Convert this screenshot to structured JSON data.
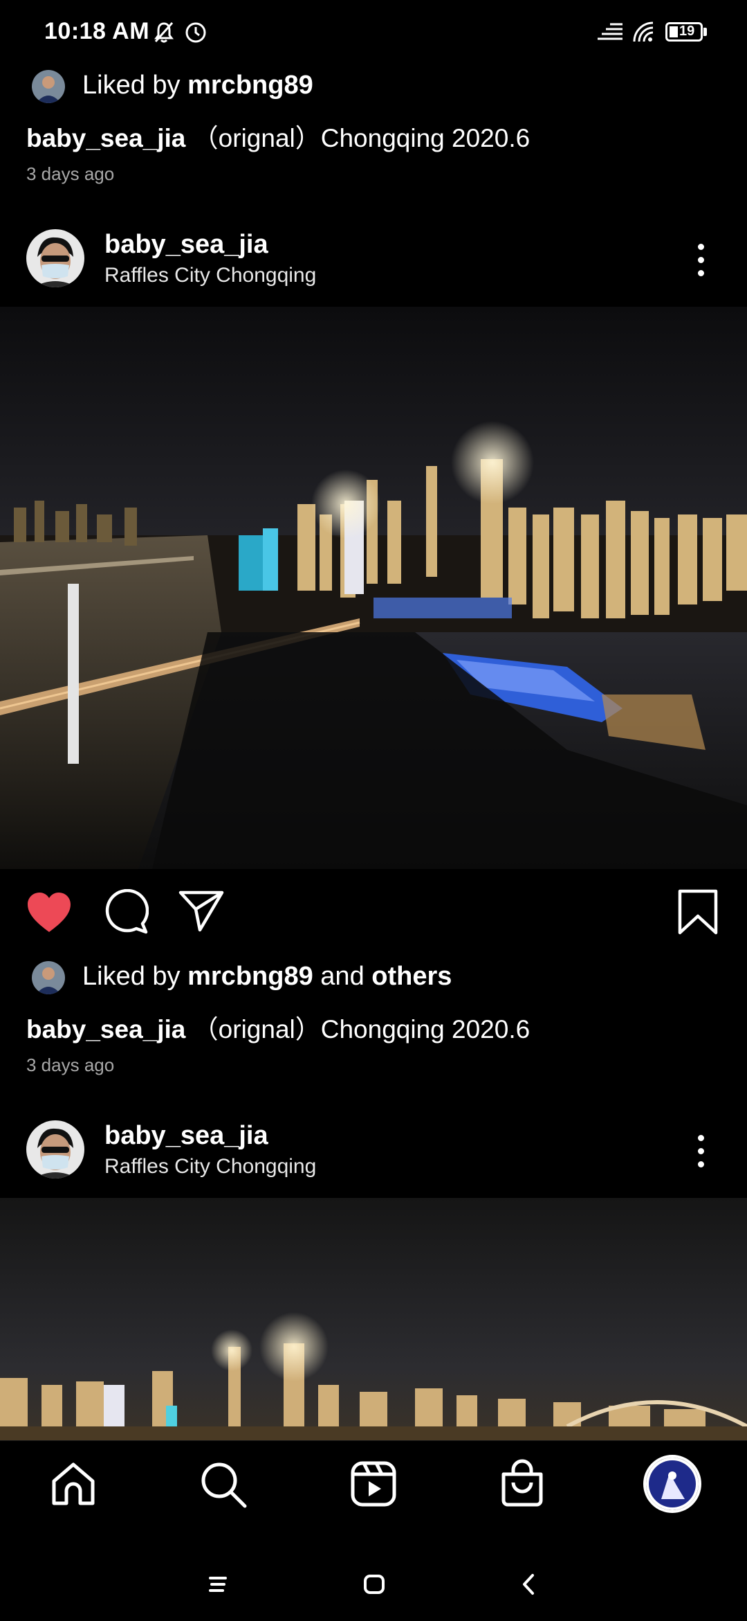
{
  "status_bar": {
    "time": "10:18 AM",
    "battery": "19"
  },
  "post_prev": {
    "liked_prefix": "Liked by",
    "liked_user": "mrcbng89",
    "caption_user": "baby_sea_jia",
    "caption_text": "（orignal）Chongqing 2020.6",
    "time_ago": "3 days ago"
  },
  "post_main": {
    "username": "baby_sea_jia",
    "location": "Raffles City Chongqing",
    "liked_prefix": "Liked by",
    "liked_user": "mrcbng89",
    "liked_and": "and",
    "liked_others": "others",
    "caption_user": "baby_sea_jia",
    "caption_text": "（orignal）Chongqing 2020.6",
    "time_ago": "3 days ago",
    "liked": true
  },
  "post_next": {
    "username": "baby_sea_jia",
    "location": "Raffles City Chongqing"
  },
  "nav": {
    "items": [
      "home-icon",
      "search-icon",
      "reels-icon",
      "shop-icon",
      "profile-avatar"
    ]
  },
  "colors": {
    "like": "#ed4956",
    "background": "#000000",
    "secondary_text": "#a8a8a8"
  }
}
